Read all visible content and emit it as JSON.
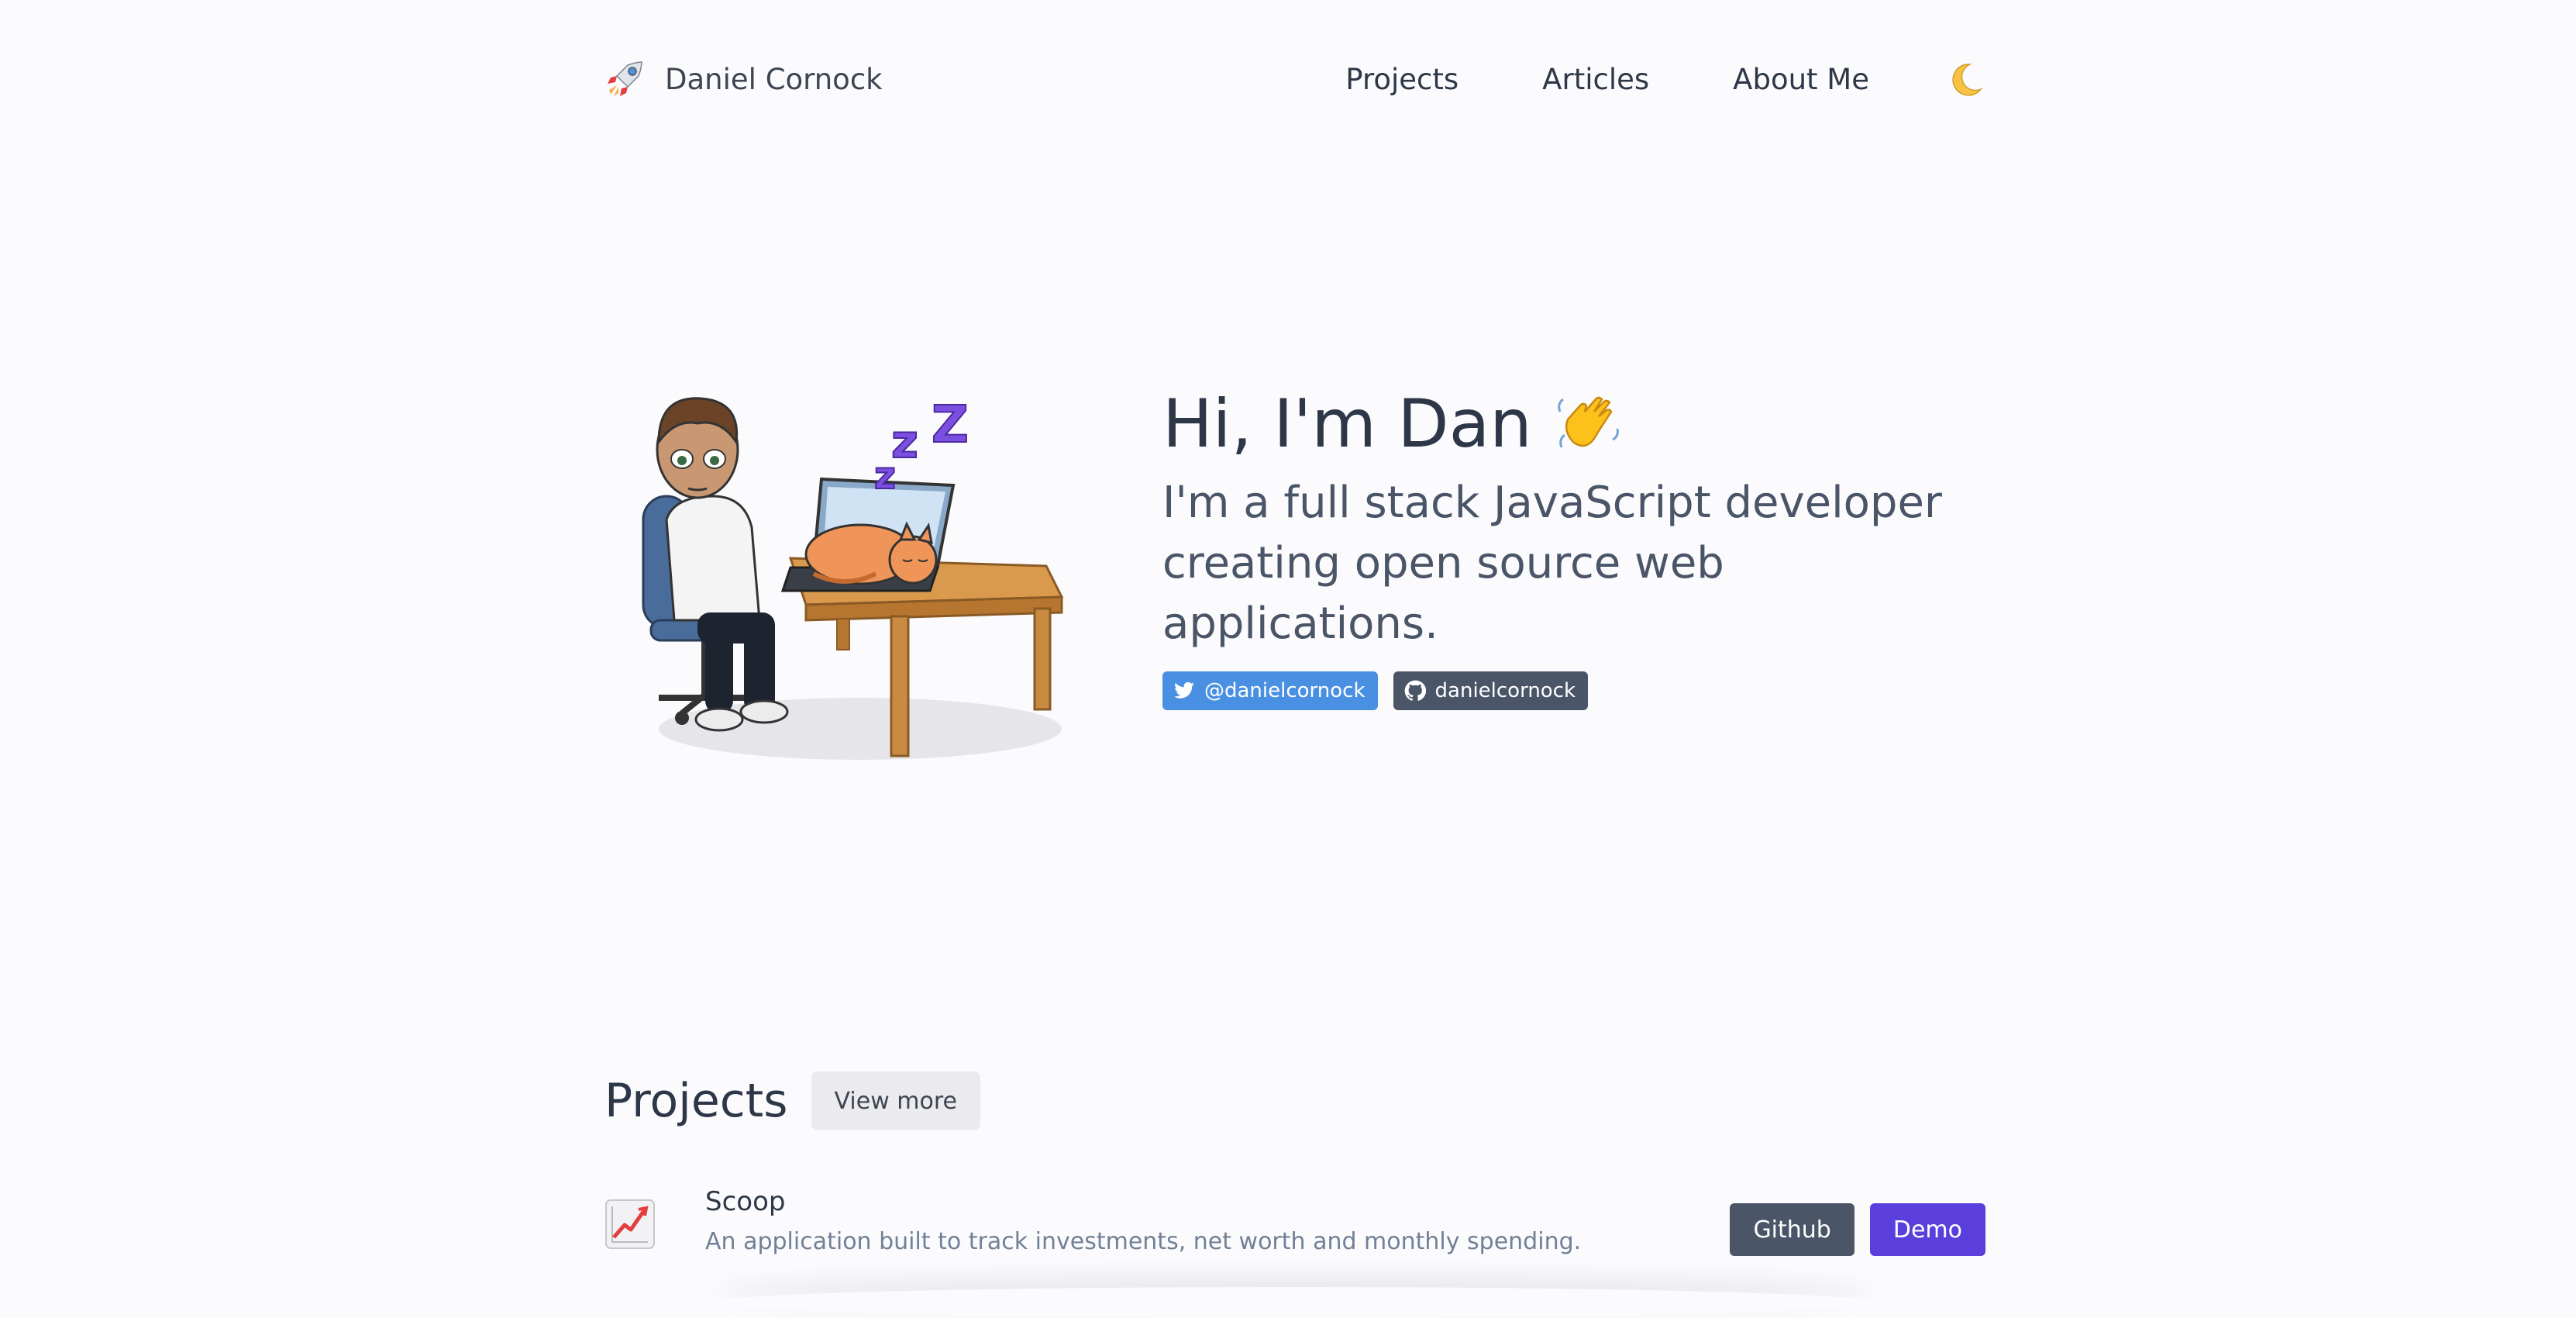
{
  "header": {
    "brand_name": "Daniel Cornock",
    "nav": [
      "Projects",
      "Articles",
      "About Me"
    ]
  },
  "hero": {
    "title": "Hi, I'm Dan",
    "subtitle": "I'm a full stack JavaScript developer creating open source web applications.",
    "twitter": "@danielcornock",
    "github": "danielcornock"
  },
  "projects": {
    "title": "Projects",
    "view_more": "View more",
    "items": [
      {
        "name": "Scoop",
        "description": "An application built to track investments, net worth and monthly spending.",
        "github_label": "Github",
        "demo_label": "Demo"
      }
    ]
  },
  "colors": {
    "background": "#fbfbfd",
    "twitter_badge": "#4a90e2",
    "github_badge": "#4a5568",
    "primary": "#5a3fdc"
  },
  "icons": [
    "rocket-icon",
    "moon-icon",
    "wave-hand-icon",
    "twitter-icon",
    "github-icon",
    "chart-increasing-icon"
  ]
}
